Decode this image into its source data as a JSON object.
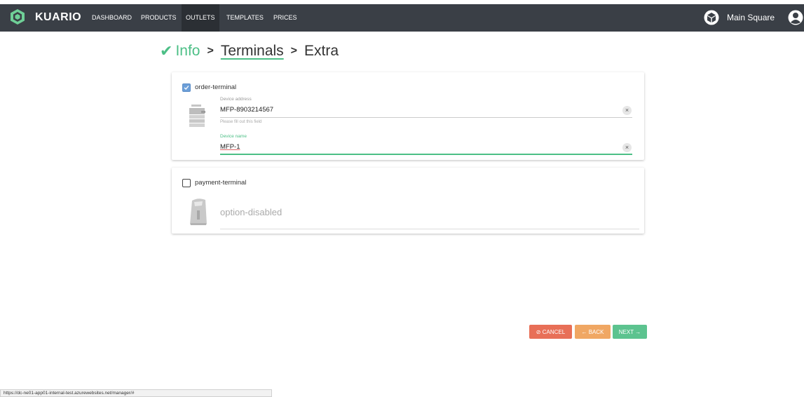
{
  "navbar": {
    "brand": "KUARIO",
    "items": [
      {
        "label": "DASHBOARD"
      },
      {
        "label": "PRODUCTS"
      },
      {
        "label": "OUTLETS"
      },
      {
        "label": "TEMPLATES"
      },
      {
        "label": "PRICES"
      }
    ],
    "active_index": 2,
    "account_name": "Main Square"
  },
  "wizard": {
    "step1": "Info",
    "step2": "Terminals",
    "step3": "Extra"
  },
  "order_terminal": {
    "checked": true,
    "label": "order-terminal",
    "address_label": "Device address",
    "address_value": "MFP-8903214567",
    "address_hint": "Please fill out this field",
    "name_label": "Device name",
    "name_value": "MFP-1",
    "clear_glyph": "×"
  },
  "payment_terminal": {
    "checked": false,
    "label": "payment-terminal",
    "disabled_text": "option-disabled"
  },
  "buttons": {
    "cancel": "⊘ CANCEL",
    "back": "← BACK",
    "next": "NEXT →"
  },
  "statusbar": {
    "url": "https://dc-ne01-app01-internal-test.azurewebsites.net/manager/#"
  },
  "colors": {
    "navbar": "#3a3f46",
    "accent_green": "#4cbf86",
    "cancel": "#e86f57",
    "back": "#f0a763",
    "next": "#5cc38f"
  }
}
